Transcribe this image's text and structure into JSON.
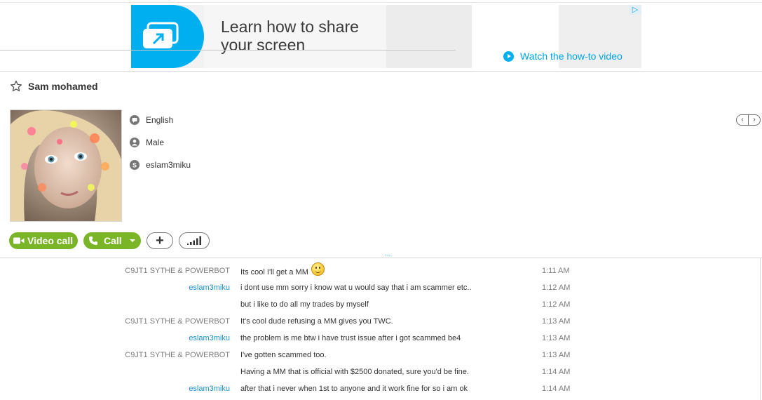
{
  "ad": {
    "headline": "Learn how to share your screen",
    "cta": "Watch the how-to video",
    "choices_icon": "ad-choices-icon"
  },
  "contact": {
    "name": "Sam mohamed",
    "details": [
      {
        "icon": "language-icon",
        "text": "English"
      },
      {
        "icon": "gender-icon",
        "text": "Male"
      },
      {
        "icon": "skype-icon",
        "text": "eslam3miku"
      }
    ]
  },
  "nav": {
    "prev": "‹",
    "next": "›"
  },
  "actions": {
    "video_call": "Video call",
    "call": "Call",
    "add": "+"
  },
  "splitter": "...",
  "messages": [
    {
      "sender": "C9JT1 SYTHE & POWERBOT",
      "sender_type": "other",
      "text": "Its cool I'll get a MM",
      "emoticon": "smile",
      "time": "1:11 AM"
    },
    {
      "sender": "eslam3miku",
      "sender_type": "me",
      "text": "i dont use mm sorry i know wat u would say that i am scammer etc..",
      "time": "1:12 AM"
    },
    {
      "sender": "",
      "sender_type": "me",
      "text": "but i like to do all my trades by myself",
      "time": "1:12 AM"
    },
    {
      "sender": "C9JT1 SYTHE & POWERBOT",
      "sender_type": "other",
      "text": "It's cool dude refusing a MM gives you TWC.",
      "time": "1:13 AM"
    },
    {
      "sender": "eslam3miku",
      "sender_type": "me",
      "text": "the problem is me btw i have trust issue after i got scammed be4",
      "time": "1:13 AM"
    },
    {
      "sender": "C9JT1 SYTHE & POWERBOT",
      "sender_type": "other",
      "text": "I've gotten scammed too.",
      "time": "1:13 AM"
    },
    {
      "sender": "",
      "sender_type": "other",
      "text": "Having a MM that is official with $2500 donated, sure you'd be fine.",
      "time": "1:14 AM"
    },
    {
      "sender": "eslam3miku",
      "sender_type": "me",
      "text": "after that i never when 1st to anyone and it work fine for so i am ok",
      "time": "1:14 AM"
    }
  ],
  "colors": {
    "skype_blue": "#00aff0",
    "call_green": "#7ab527",
    "link_blue": "#1a8fc7"
  }
}
